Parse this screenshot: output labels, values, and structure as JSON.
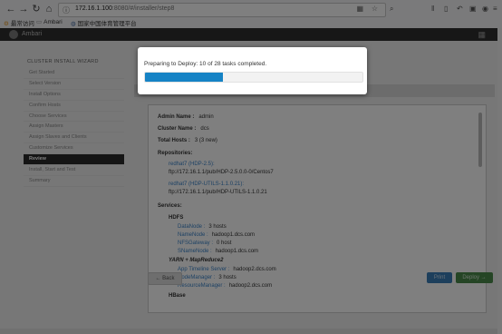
{
  "browser": {
    "url_host": "172.16.1.100",
    "url_path": ":8080/#/installer/step8",
    "bookmarks": [
      "最常访问",
      "Ambari",
      "国家中国体育管理平台"
    ]
  },
  "app": {
    "brand": "Ambari"
  },
  "sidebar": {
    "title": "CLUSTER INSTALL WIZARD",
    "steps": [
      {
        "label": "Get Started"
      },
      {
        "label": "Select Version"
      },
      {
        "label": "Install Options"
      },
      {
        "label": "Confirm Hosts"
      },
      {
        "label": "Choose Services"
      },
      {
        "label": "Assign Masters"
      },
      {
        "label": "Assign Slaves and Clients"
      },
      {
        "label": "Customize Services"
      },
      {
        "label": "Review"
      },
      {
        "label": "Install, Start and Test"
      },
      {
        "label": "Summary"
      }
    ]
  },
  "review": {
    "admin_name_label": "Admin Name :",
    "admin_name": "admin",
    "cluster_name_label": "Cluster Name :",
    "cluster_name": "dcs",
    "total_hosts_label": "Total Hosts :",
    "total_hosts": "3 (3 new)",
    "repositories_label": "Repositories:",
    "repo1_name": "redhat7 (HDP-2.5):",
    "repo1_url": "ftp://172.16.1.1/pub/HDP-2.5.0.0-0/Centos7",
    "repo2_name": "redhat7 (HDP-UTILS-1.1.0.21):",
    "repo2_url": "ftp://172.16.1.1/pub/HDP-UTILS-1.1.0.21",
    "services_label": "Services:",
    "hdfs_label": "HDFS",
    "hdfs_rows": [
      {
        "k": "DataNode :",
        "v": "3 hosts"
      },
      {
        "k": "NameNode :",
        "v": "hadoop1.dcs.com"
      },
      {
        "k": "NFSGateway :",
        "v": "0 host"
      },
      {
        "k": "SNameNode :",
        "v": "hadoop1.dcs.com"
      }
    ],
    "yarn_label": "YARN + MapReduce2",
    "yarn_rows": [
      {
        "k": "App Timeline Server :",
        "v": "hadoop2.dcs.com"
      },
      {
        "k": "NodeManager :",
        "v": "3 hosts"
      },
      {
        "k": "ResourceManager :",
        "v": "hadoop2.dcs.com"
      }
    ],
    "hbase_label": "HBase"
  },
  "buttons": {
    "back": "← Back",
    "print": "Print",
    "deploy": "Deploy →"
  },
  "modal": {
    "message": "Preparing to Deploy: 10 of 28 tasks completed.",
    "progress_fraction": 0.357
  },
  "colors": {
    "progress": "#1683c5",
    "sidebar_active": "#2a2a2a",
    "print_button": "#3a7fb8",
    "deploy_button": "#4a8b4a"
  }
}
